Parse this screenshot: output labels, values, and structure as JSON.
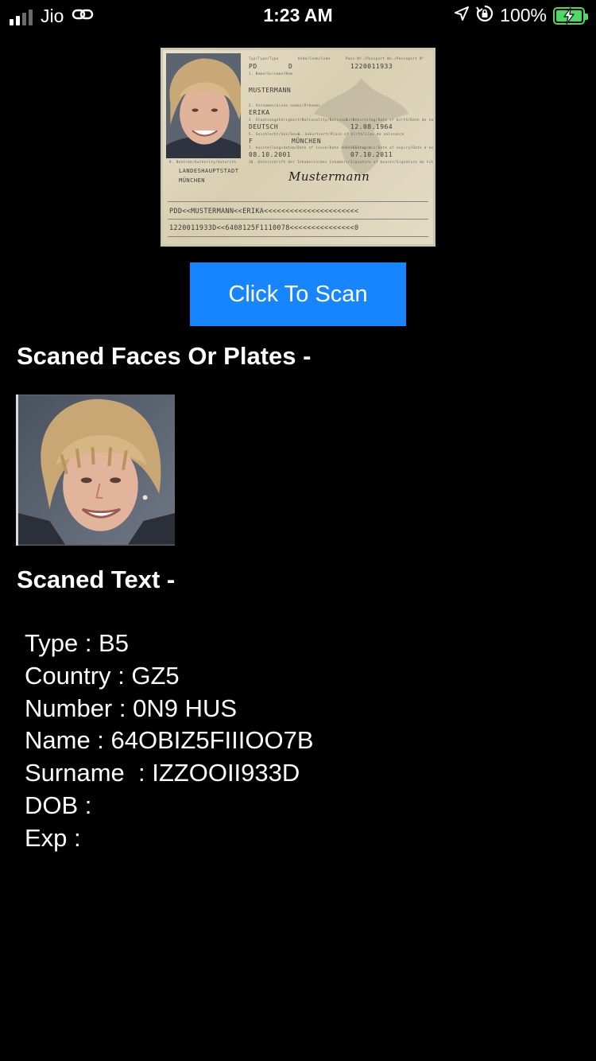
{
  "status_bar": {
    "carrier": "Jio",
    "time": "1:23 AM",
    "battery_percent": "100%",
    "signal_bars": 4,
    "signal_active": 2,
    "icons": [
      "signal-icon",
      "link-icon",
      "location-arrow-icon",
      "rotation-lock-icon",
      "battery-charging-icon"
    ]
  },
  "id_card": {
    "type_code": "PD",
    "code": "D",
    "passport_number": "1220011933",
    "surname": "MUSTERMANN",
    "given_name": "ERIKA",
    "nationality": "DEUTSCH",
    "dob": "12.08.1964",
    "sex": "F",
    "place_of_birth": "MÜNCHEN",
    "issue_date": "08.10.2001",
    "expiry_date": "07.10.2011",
    "authority_line1": "LANDESHAUPTSTADT",
    "authority_line2": "MÜNCHEN",
    "signature": "Mustermann",
    "mrz_line1": "PDD<<MUSTERMANN<<ERIKA<<<<<<<<<<<<<<<<<<<<<<",
    "mrz_line2": "1220011933D<<6408125F1110078<<<<<<<<<<<<<<<0"
  },
  "scan_button": {
    "label": "Click To Scan"
  },
  "faces_section": {
    "title": "Scaned Faces Or Plates -"
  },
  "text_section": {
    "title": "Scaned Text -",
    "rows": [
      "Type : B5",
      "Country : GZ5",
      "Number : 0N9 HUS",
      "Name : 64OBIZ5FIIIOO7B",
      "Surname  : IZZOOII933D",
      "DOB :",
      "Exp :"
    ]
  },
  "colors": {
    "background": "#000000",
    "button": "#1685ff",
    "battery": "#4cd964"
  }
}
